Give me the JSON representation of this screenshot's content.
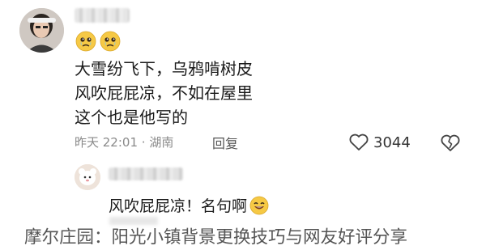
{
  "comment": {
    "text_lines": [
      "大雪纷飞下，乌鸦啃树皮",
      "风吹屁屁凉，不如在屋里",
      "这个也是他写的"
    ],
    "timestamp": "昨天 22:01",
    "separator": "·",
    "location": "湖南",
    "reply_label": "回复",
    "like_count": "3044",
    "icons": [
      "crying-emoji-icon",
      "crying-emoji-icon",
      "heart-outline-icon",
      "broken-heart-icon"
    ]
  },
  "reply": {
    "text": "风吹屁屁凉！名句啊",
    "icons": [
      "grinning-emoji-icon"
    ]
  },
  "watermark": {
    "text": "摩尔庄园：阳光小镇背景更换技巧与网友好评分享"
  },
  "colors": {
    "text": "#1a1a1a",
    "meta": "#8a8a8a",
    "emoji_yellow": "#f6c945",
    "background": "#ffffff"
  }
}
